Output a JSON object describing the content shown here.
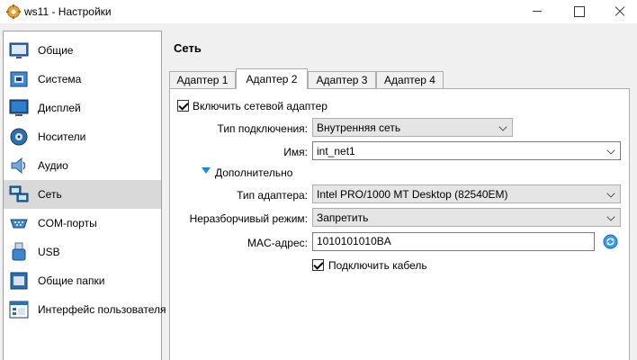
{
  "window": {
    "title": "ws11 - Настройки"
  },
  "sidebar": {
    "items": [
      {
        "label": "Общие",
        "icon": "general-monitor-icon"
      },
      {
        "label": "Система",
        "icon": "system-chip-icon"
      },
      {
        "label": "Дисплей",
        "icon": "display-monitor-icon"
      },
      {
        "label": "Носители",
        "icon": "storage-disk-icon"
      },
      {
        "label": "Аудио",
        "icon": "audio-speaker-icon"
      },
      {
        "label": "Сеть",
        "icon": "network-icon"
      },
      {
        "label": "COM-порты",
        "icon": "serial-port-icon"
      },
      {
        "label": "USB",
        "icon": "usb-icon"
      },
      {
        "label": "Общие папки",
        "icon": "shared-folder-icon"
      },
      {
        "label": "Интерфейс пользователя",
        "icon": "user-interface-icon"
      }
    ],
    "selected": "Сеть"
  },
  "main": {
    "section_title": "Сеть",
    "tabs": [
      {
        "label": "Адаптер 1"
      },
      {
        "label": "Адаптер 2"
      },
      {
        "label": "Адаптер 3"
      },
      {
        "label": "Адаптер 4"
      }
    ],
    "active_tab": "Адаптер 2",
    "enable_adapter": {
      "label": "Включить сетевой адаптер",
      "checked": true
    },
    "attached_to": {
      "label": "Тип подключения:",
      "value": "Внутренняя сеть"
    },
    "name": {
      "label": "Имя:",
      "value": "int_net1"
    },
    "advanced": {
      "label": "Дополнительно",
      "expanded": true
    },
    "adapter_type": {
      "label": "Тип адаптера:",
      "value": "Intel PRO/1000 MT Desktop (82540EM)"
    },
    "promiscuous": {
      "label": "Неразборчивый режим:",
      "value": "Запретить"
    },
    "mac": {
      "label": "MAC-адрес:",
      "value": "1010101010BA"
    },
    "cable": {
      "label": "Подключить кабель",
      "checked": true
    }
  },
  "colors": {
    "accent": "#1c8ae0",
    "selected_bg": "#d9d9d9",
    "window_bg": "#f0f0f0"
  }
}
